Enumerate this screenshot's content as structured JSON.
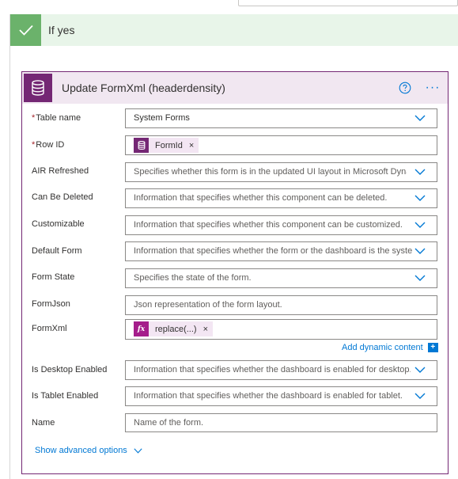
{
  "colors": {
    "condition_green": "#6bb26b",
    "condition_bg": "#e8f5e9",
    "dataverse_purple": "#742774",
    "card_header_bg": "#f1e7f1",
    "link_blue": "#0078d4",
    "required_red": "#a4262c"
  },
  "condition": {
    "icon": "checkmark-icon",
    "title": "If yes"
  },
  "action": {
    "icon": "dataverse-icon",
    "title": "Update FormXml (headerdensity)",
    "help_icon": "help-icon",
    "menu_icon": "more-options-icon",
    "menu_label": "···"
  },
  "fields": {
    "table_name": {
      "required_mark": "*",
      "label": "Table name",
      "value": "System Forms"
    },
    "row_id": {
      "required_mark": "*",
      "label": "Row ID",
      "token": "FormId",
      "token_close": "×"
    },
    "air_refreshed": {
      "label": "AIR Refreshed",
      "placeholder": "Specifies whether this form is in the updated UI layout in Microsoft Dyna"
    },
    "can_be_deleted": {
      "label": "Can Be Deleted",
      "placeholder": "Information that specifies whether this component can be deleted."
    },
    "customizable": {
      "label": "Customizable",
      "placeholder": "Information that specifies whether this component can be customized."
    },
    "default_form": {
      "label": "Default Form",
      "placeholder": "Information that specifies whether the form or the dashboard is the syste"
    },
    "form_state": {
      "label": "Form State",
      "placeholder": "Specifies the state of the form."
    },
    "form_json": {
      "label": "FormJson",
      "placeholder": "Json representation of the form layout."
    },
    "form_xml": {
      "label": "FormXml",
      "token": "replace(...)",
      "token_icon_label": "fx",
      "token_close": "×"
    },
    "is_desktop_enabled": {
      "label": "Is Desktop Enabled",
      "placeholder": "Information that specifies whether the dashboard is enabled for desktop."
    },
    "is_tablet_enabled": {
      "label": "Is Tablet Enabled",
      "placeholder": "Information that specifies whether the dashboard is enabled for tablet."
    },
    "name": {
      "label": "Name",
      "placeholder": "Name of the form."
    }
  },
  "add_dynamic_content": {
    "label": "Add dynamic content",
    "icon_label": "+"
  },
  "show_advanced": {
    "label": "Show advanced options"
  }
}
